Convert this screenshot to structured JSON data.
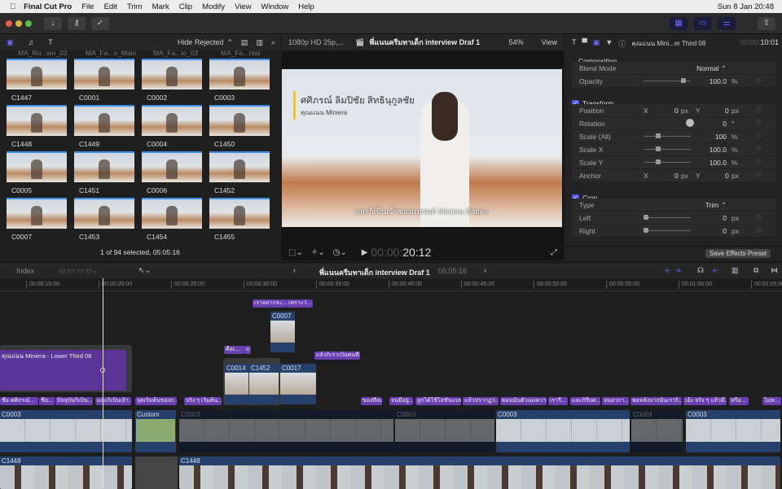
{
  "menubar": {
    "app": "Final Cut Pro",
    "items": [
      "File",
      "Edit",
      "Trim",
      "Mark",
      "Clip",
      "Modify",
      "View",
      "Window",
      "Help"
    ],
    "clock": "Sun 8 Jan  20:48"
  },
  "browser": {
    "filter": "Hide Rejected",
    "top_labels": [
      "MA_Ro...wn_03",
      "MA_Fa...o_Main",
      "MA_Fa...io_03",
      "MA_Fa...ntal"
    ],
    "clips": [
      "C1447",
      "C0001",
      "C0002",
      "C0003",
      "C1448",
      "C1449",
      "C0004",
      "C1450",
      "C0005",
      "C1451",
      "C0006",
      "C1452",
      "C0007",
      "C1453",
      "C1454",
      "C1455"
    ],
    "status": "1 of 94 selected, 05:05:16"
  },
  "viewer": {
    "format": "1080p HD 25p,...",
    "project": "พี่แนนครีมทาเด็ก interview Draf 1",
    "zoom": "54%",
    "view": "View",
    "lower_third_name": "ศศิภรณ์ ลิมปิชัย สิทธินุกูลชัย",
    "lower_third_sub": "คุณแนน Miniera",
    "subtitle": "และก็เป็นเจ้าของแบรนด์ Miniera ด้วยค่ะ",
    "timecode_dim": "00:00:",
    "timecode": "20:12"
  },
  "inspector": {
    "title": "คุณแนน Mini...er Third 08",
    "tc_dim": "00:00:",
    "tc": "10:01",
    "compositing": "Compositing",
    "blend_label": "Blend Mode",
    "blend": "Normal ⌃",
    "opacity_label": "Opacity",
    "opacity": "100.0",
    "pct": "%",
    "transform": "Transform",
    "position": "Position",
    "rotation": "Rotation",
    "rot_val": "0",
    "deg": "°",
    "scale_all": "Scale (All)",
    "scale_all_val": "100",
    "scale_x": "Scale X",
    "scale_x_val": "100.0",
    "scale_y": "Scale Y",
    "scale_y_val": "100.0",
    "anchor": "Anchor",
    "x": "X",
    "y": "Y",
    "zero": "0",
    "px": "px",
    "crop": "Crop",
    "type": "Type",
    "type_val": "Trim ⌃",
    "left": "Left",
    "right": "Right",
    "save_preset": "Save Effects Preset"
  },
  "timeline": {
    "index": "Index",
    "project": "พี่แนนครีมทาเด็ก interview Draf 1",
    "duration": "05:05:16",
    "ticks": [
      "00:00:15:00",
      "00:00:20:00",
      "00:00:25:00",
      "00:00:30:00",
      "00:00:35:00",
      "00:00:40:00",
      "00:00:45:00",
      "00:00:50:00",
      "00:00:55:00",
      "00:01:00:00",
      "00:01:05:00"
    ],
    "upper_captions": [
      "เราอยากจะ...",
      "เพราะว่...",
      "คือเ...",
      "แ",
      "แล้วก็เราเป็นคนที่..."
    ],
    "lower_third": "คุณแนน Miniera - Lower Third 08",
    "connected": [
      "C0007",
      "C0014",
      "C1452",
      "C0017"
    ],
    "captions": [
      "ชื่อ ศศิภรณ์...",
      "ชื่อ...",
      "ปัจจุบันก็เป็น...",
      "และก็เป็นเจ้า...",
      "จุดเริ่มต้นของก...",
      "จริง ๆ เริ่มต้น...",
      "ของที่จะ...",
      "จนมีอยู่...",
      "ลูกได้ใช้โลชั่นแบท...",
      "แล้วปรากฏว่...",
      "ตอนนั้นตัวเองความ...",
      "เรารี...",
      "และก็รีบศ...",
      "จนอากา...",
      "พอหลังจากนั้นเราก็...",
      "เอ้ะ จริง ๆ แล้วมี...",
      "หรือ...",
      "ไม่ท..."
    ],
    "primary": [
      "C0003",
      "Custom",
      "C0003",
      "C0003",
      "C0003",
      "C0003",
      "C0003"
    ],
    "secondary": [
      "C1448",
      "C1448"
    ]
  }
}
